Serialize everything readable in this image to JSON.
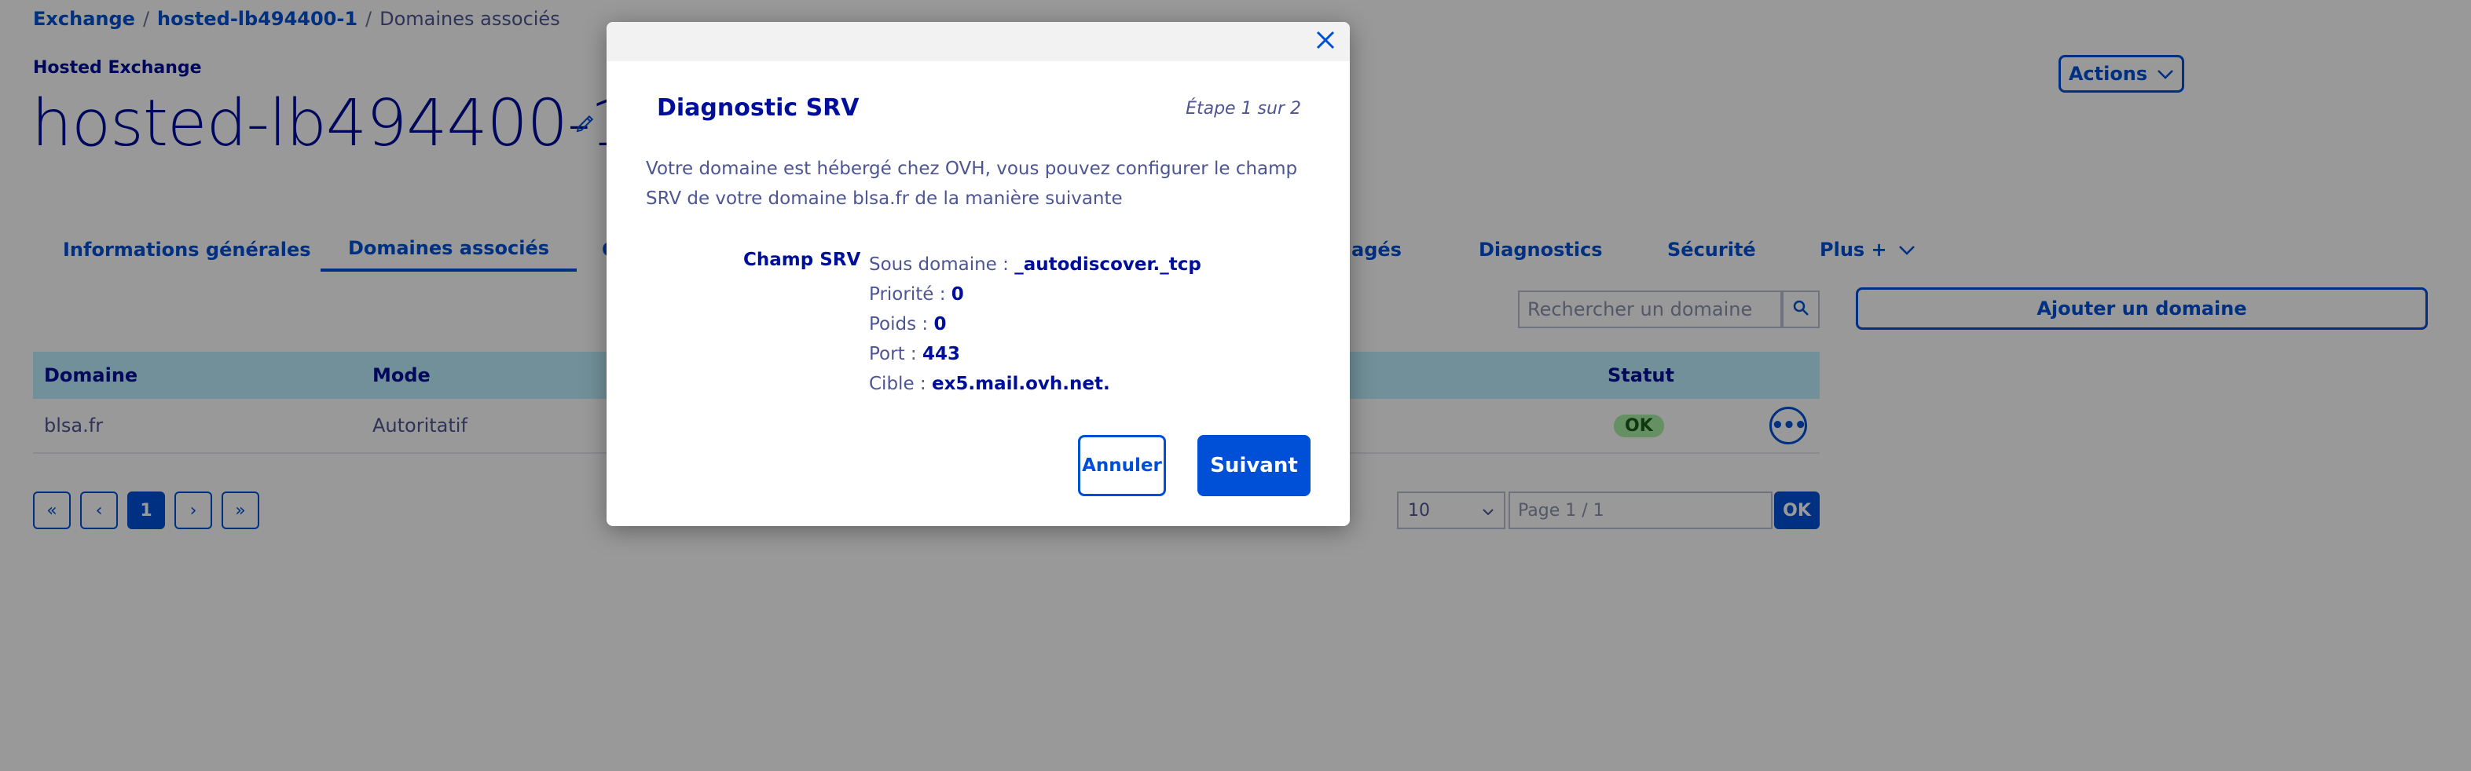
{
  "breadcrumb": {
    "items": [
      "Exchange",
      "hosted-lb494400-1",
      "Domaines associés"
    ]
  },
  "header": {
    "eyebrow": "Hosted Exchange",
    "title": "hosted-lb494400-1",
    "actions_label": "Actions"
  },
  "tabs": [
    {
      "label": "Informations générales"
    },
    {
      "label": "Domaines associés"
    },
    {
      "label": "C"
    },
    {
      "label": "agés"
    },
    {
      "label": "Diagnostics"
    },
    {
      "label": "Sécurité"
    },
    {
      "label": "Plus +"
    }
  ],
  "toolbar": {
    "search_placeholder": "Rechercher un domaine",
    "add_label": "Ajouter un domaine"
  },
  "table": {
    "columns": [
      "Domaine",
      "Mode",
      "Statut"
    ],
    "rows": [
      {
        "domain": "blsa.fr",
        "mode": "Autoritatif",
        "status": "OK"
      }
    ]
  },
  "pagination": {
    "first": "«",
    "prev": "‹",
    "current": "1",
    "next": "›",
    "last": "»",
    "page_size": "10",
    "page_placeholder": "Page 1 / 1",
    "ok_label": "OK"
  },
  "modal": {
    "title": "Diagnostic SRV",
    "step": "Étape 1 sur 2",
    "intro": "Votre domaine est hébergé chez OVH, vous pouvez configurer le champ SRV de votre domaine blsa.fr de la manière suivante",
    "srv_label": "Champ SRV",
    "fields": [
      {
        "label": "Sous domaine : ",
        "value": "_autodiscover._tcp"
      },
      {
        "label": "Priorité : ",
        "value": "0"
      },
      {
        "label": "Poids : ",
        "value": "0"
      },
      {
        "label": "Port : ",
        "value": "443"
      },
      {
        "label": "Cible : ",
        "value": "ex5.mail.ovh.net."
      }
    ],
    "cancel_label": "Annuler",
    "next_label": "Suivant"
  },
  "colors": {
    "primary": "#0050d7",
    "heading": "#000e9c",
    "table_header": "#bef1ff",
    "ok_badge": "#a8f1a5"
  }
}
